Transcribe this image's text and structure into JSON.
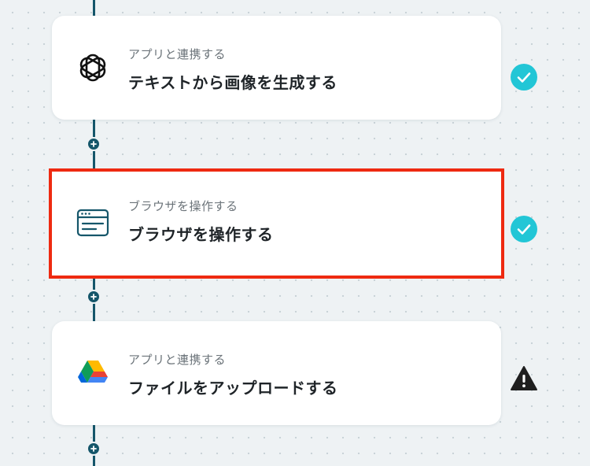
{
  "flow": {
    "steps": [
      {
        "subtitle": "アプリと連携する",
        "title": "テキストから画像を生成する",
        "icon": "openai-icon",
        "status": "complete",
        "selected": false
      },
      {
        "subtitle": "ブラウザを操作する",
        "title": "ブラウザを操作する",
        "icon": "browser-window-icon",
        "status": "complete",
        "selected": true
      },
      {
        "subtitle": "アプリと連携する",
        "title": "ファイルをアップロードする",
        "icon": "google-drive-icon",
        "status": "warning",
        "selected": false
      }
    ]
  },
  "colors": {
    "connector": "#15566a",
    "check_badge": "#22c6d6",
    "warning": "#1f1f1f",
    "selection_border": "#ee2a11",
    "background": "#eef2f4"
  }
}
